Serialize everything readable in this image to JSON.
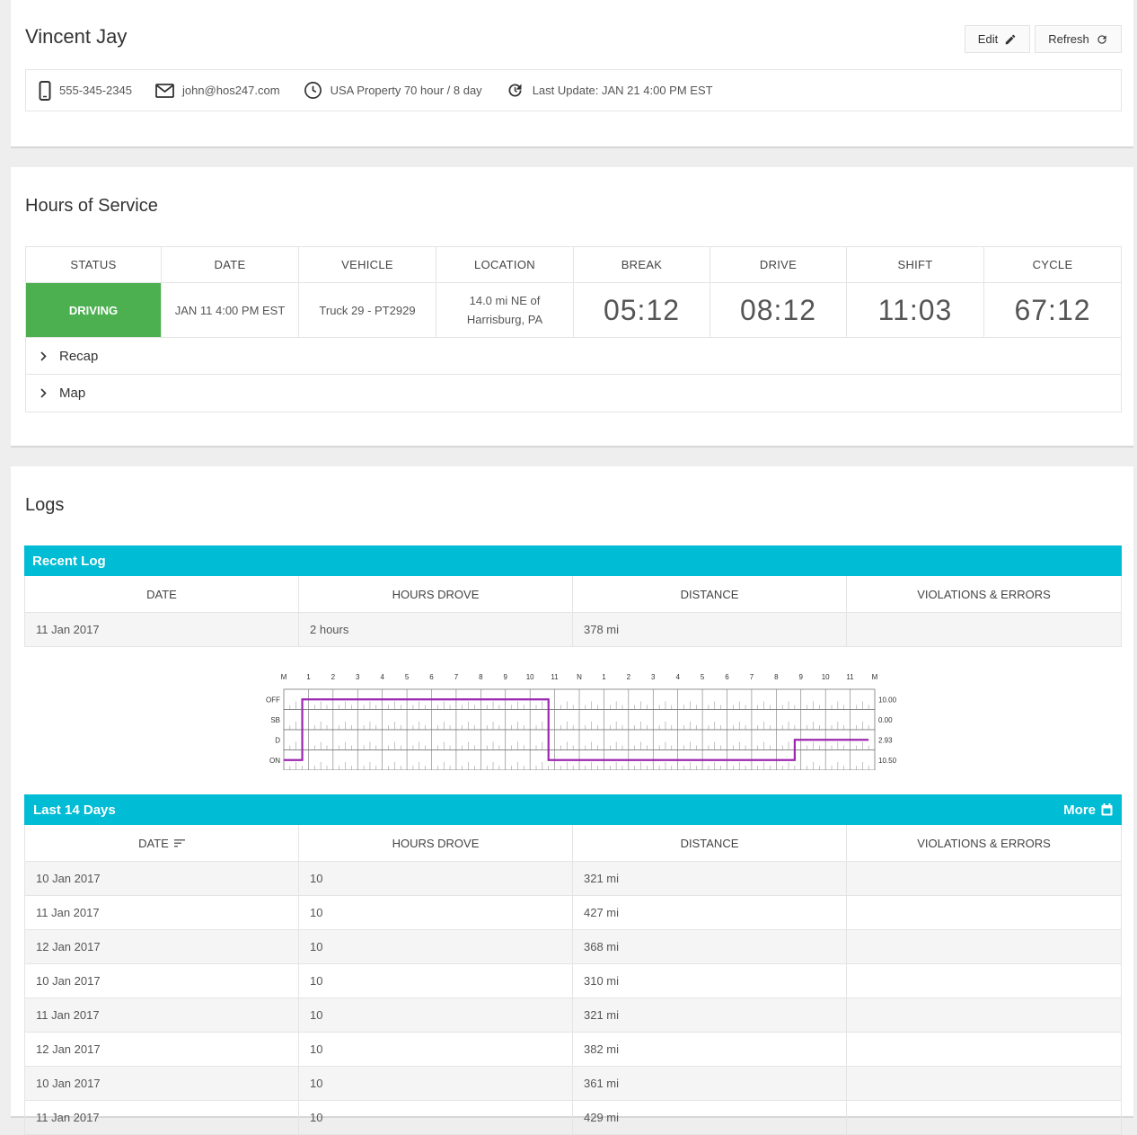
{
  "driver": {
    "name": "Vincent Jay",
    "edit_label": "Edit",
    "refresh_label": "Refresh",
    "phone": "555-345-2345",
    "email": "john@hos247.com",
    "ruleset": "USA Property 70 hour / 8 day",
    "last_update": "Last Update: JAN 21 4:00 PM EST"
  },
  "hos": {
    "title": "Hours of Service",
    "headers": [
      "STATUS",
      "DATE",
      "VEHICLE",
      "LOCATION",
      "BREAK",
      "DRIVE",
      "SHIFT",
      "CYCLE"
    ],
    "status": "DRIVING",
    "date": "JAN 11 4:00 PM EST",
    "vehicle": "Truck 29 - PT2929",
    "location_line1": "14.0 mi NE of",
    "location_line2": "Harrisburg, PA",
    "break": "05:12",
    "drive": "08:12",
    "shift": "11:03",
    "cycle": "67:12",
    "recap_label": "Recap",
    "map_label": "Map",
    "status_color": "#4caf50"
  },
  "logs": {
    "title": "Logs",
    "accent_color": "#00bcd4",
    "recent": {
      "bar_label": "Recent Log",
      "headers": [
        "DATE",
        "HOURS DROVE",
        "DISTANCE",
        "VIOLATIONS & ERRORS"
      ],
      "row": {
        "date": "11 Jan 2017",
        "hours": "2 hours",
        "distance": "378 mi",
        "violations": ""
      }
    },
    "graph": {
      "hour_labels": [
        "M",
        "1",
        "2",
        "3",
        "4",
        "5",
        "6",
        "7",
        "8",
        "9",
        "10",
        "11",
        "N",
        "1",
        "2",
        "3",
        "4",
        "5",
        "6",
        "7",
        "8",
        "9",
        "10",
        "11",
        "M"
      ],
      "row_labels": [
        "OFF",
        "SB",
        "D",
        "ON"
      ],
      "totals": [
        "10.00",
        "0.00",
        "2.93",
        "10.50"
      ],
      "segments": [
        {
          "status": "ON",
          "start": 0,
          "end": 0.75
        },
        {
          "status": "OFF",
          "start": 0.75,
          "end": 10.75
        },
        {
          "status": "ON",
          "start": 10.75,
          "end": 20.75
        },
        {
          "status": "D",
          "start": 20.75,
          "end": 23.75
        }
      ],
      "line_color": "#9c27b0"
    },
    "last14": {
      "bar_label": "Last 14 Days",
      "more_label": "More",
      "headers": [
        "DATE",
        "HOURS DROVE",
        "DISTANCE",
        "VIOLATIONS & ERRORS"
      ],
      "rows": [
        {
          "date": "10 Jan 2017",
          "hours": "10",
          "distance": "321 mi",
          "violations": ""
        },
        {
          "date": "11 Jan 2017",
          "hours": "10",
          "distance": "427 mi",
          "violations": ""
        },
        {
          "date": "12 Jan 2017",
          "hours": "10",
          "distance": "368 mi",
          "violations": ""
        },
        {
          "date": "10 Jan 2017",
          "hours": "10",
          "distance": "310 mi",
          "violations": ""
        },
        {
          "date": "11 Jan 2017",
          "hours": "10",
          "distance": "321 mi",
          "violations": ""
        },
        {
          "date": "12 Jan 2017",
          "hours": "10",
          "distance": "382 mi",
          "violations": ""
        },
        {
          "date": "10 Jan 2017",
          "hours": "10",
          "distance": "361 mi",
          "violations": ""
        },
        {
          "date": "11 Jan 2017",
          "hours": "10",
          "distance": "429 mi",
          "violations": ""
        }
      ]
    }
  }
}
